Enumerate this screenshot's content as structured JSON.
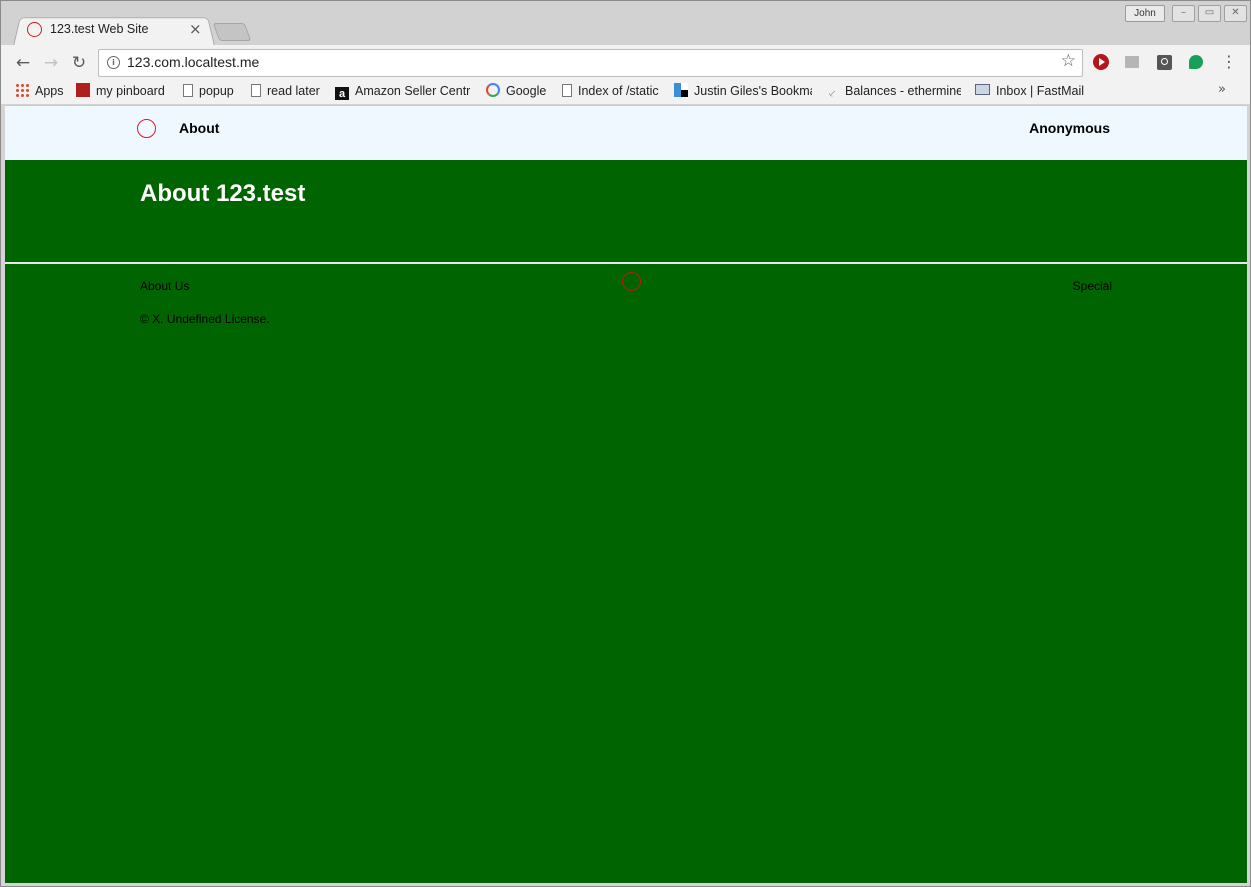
{
  "browser": {
    "tab_title": "123.test Web Site",
    "tab_close": "×",
    "profile_name": "John",
    "url": "123.com.localtest.me",
    "bookmarks": [
      {
        "label": "Apps",
        "icon": "apps-grid-icon"
      },
      {
        "label": "my pinboard",
        "icon": "pinboard-icon"
      },
      {
        "label": "popup",
        "icon": "page-icon"
      },
      {
        "label": "read later",
        "icon": "page-icon"
      },
      {
        "label": "Amazon Seller Centr",
        "icon": "amazon-icon"
      },
      {
        "label": "Google",
        "icon": "google-icon"
      },
      {
        "label": "Index of /static",
        "icon": "page-icon"
      },
      {
        "label": "Justin Giles's Bookma",
        "icon": "delicious-icon"
      },
      {
        "label": "Balances - ethermine",
        "icon": "ethermine-icon"
      },
      {
        "label": "Inbox | FastMail",
        "icon": "mail-icon"
      }
    ],
    "overflow_chevron": "»"
  },
  "site": {
    "nav_about": "About",
    "nav_user": "Anonymous",
    "page_title": "About 123.test",
    "footer_about": "About Us",
    "footer_special": "Special",
    "copyright": "© X. Undefined License.",
    "colors": {
      "header_bg": "#f0f8ff",
      "page_bg": "#006400",
      "logo_ring": "#d42020"
    }
  }
}
